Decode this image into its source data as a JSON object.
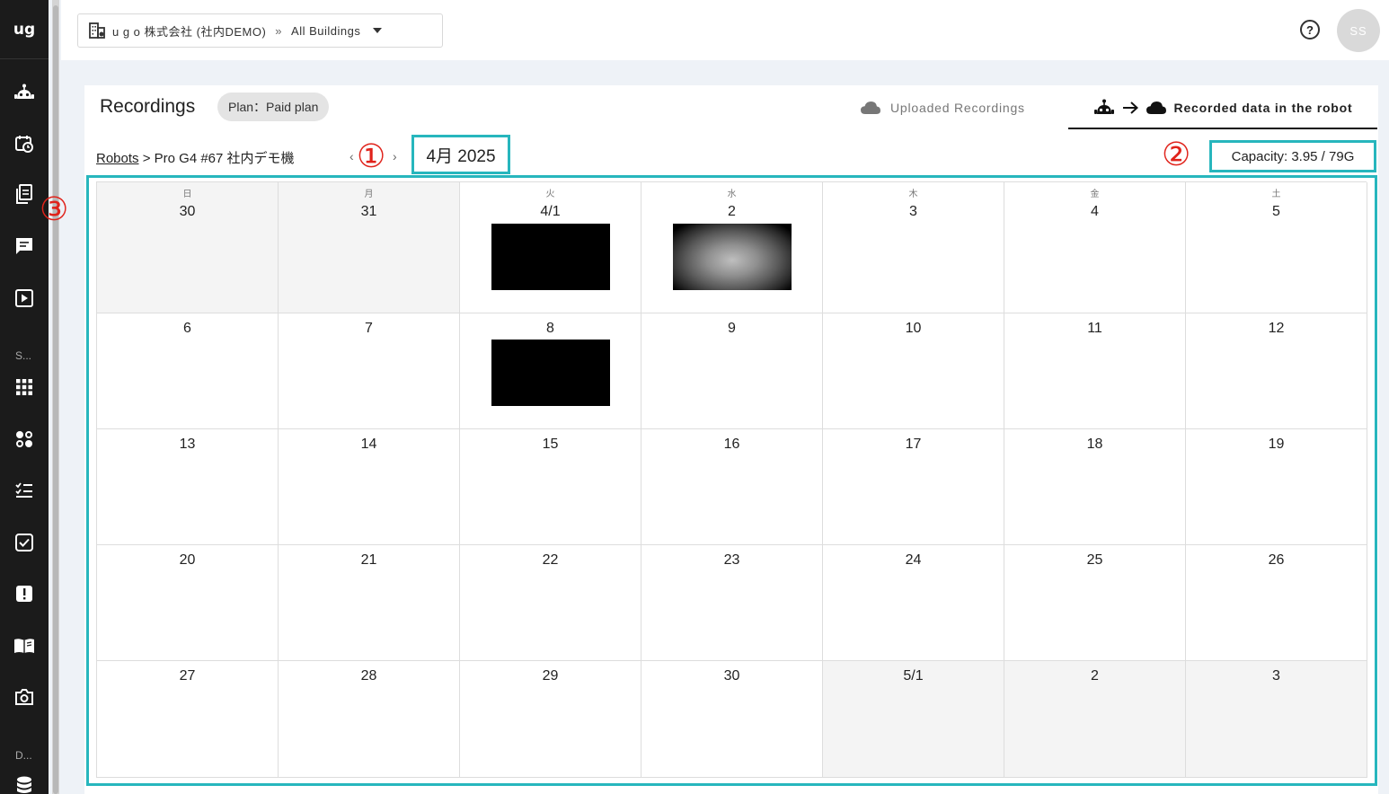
{
  "sidebar": {
    "logo": "ug",
    "section_labels": [
      "S...",
      "D..."
    ],
    "icons": [
      "robot-icon",
      "schedule-icon",
      "document-icon",
      "chat-icon",
      "play-icon",
      "grid-icon",
      "connection-icon",
      "checklist-icon",
      "check-box-icon",
      "alert-icon",
      "manual-icon",
      "camera-icon",
      "database-icon"
    ]
  },
  "topbar": {
    "company": "u g o 株式会社 (社内DEMO)",
    "separator": "»",
    "building": "All Buildings",
    "help": "?",
    "avatar": "SS"
  },
  "page": {
    "title": "Recordings",
    "plan": "Plan：Paid plan",
    "tabs": {
      "uploaded": "Uploaded Recordings",
      "recorded": "Recorded data in the robot",
      "active": "recorded"
    },
    "breadcrumb": {
      "root": "Robots",
      "separator": ">",
      "robot": "Pro G4 #67 社内デモ機"
    },
    "nav": {
      "prev": "‹",
      "next": "›"
    },
    "month": "4月 2025",
    "capacity": "Capacity: 3.95 / 79G"
  },
  "markers": [
    "①",
    "②",
    "③"
  ],
  "calendar": {
    "weekdays": [
      "日",
      "月",
      "火",
      "水",
      "木",
      "金",
      "土"
    ],
    "weeks": [
      [
        {
          "label": "30",
          "other": true,
          "thumb": ""
        },
        {
          "label": "31",
          "other": true,
          "thumb": ""
        },
        {
          "label": "4/1",
          "other": false,
          "thumb": "black"
        },
        {
          "label": "2",
          "other": false,
          "thumb": "camera"
        },
        {
          "label": "3",
          "other": false,
          "thumb": ""
        },
        {
          "label": "4",
          "other": false,
          "thumb": ""
        },
        {
          "label": "5",
          "other": false,
          "thumb": ""
        }
      ],
      [
        {
          "label": "6",
          "other": false,
          "thumb": ""
        },
        {
          "label": "7",
          "other": false,
          "thumb": ""
        },
        {
          "label": "8",
          "other": false,
          "thumb": "black"
        },
        {
          "label": "9",
          "other": false,
          "thumb": ""
        },
        {
          "label": "10",
          "other": false,
          "thumb": ""
        },
        {
          "label": "11",
          "other": false,
          "thumb": ""
        },
        {
          "label": "12",
          "other": false,
          "thumb": ""
        }
      ],
      [
        {
          "label": "13",
          "other": false,
          "thumb": ""
        },
        {
          "label": "14",
          "other": false,
          "thumb": ""
        },
        {
          "label": "15",
          "other": false,
          "thumb": ""
        },
        {
          "label": "16",
          "other": false,
          "thumb": ""
        },
        {
          "label": "17",
          "other": false,
          "thumb": ""
        },
        {
          "label": "18",
          "other": false,
          "thumb": ""
        },
        {
          "label": "19",
          "other": false,
          "thumb": ""
        }
      ],
      [
        {
          "label": "20",
          "other": false,
          "thumb": ""
        },
        {
          "label": "21",
          "other": false,
          "thumb": ""
        },
        {
          "label": "22",
          "other": false,
          "thumb": ""
        },
        {
          "label": "23",
          "other": false,
          "thumb": ""
        },
        {
          "label": "24",
          "other": false,
          "thumb": ""
        },
        {
          "label": "25",
          "other": false,
          "thumb": ""
        },
        {
          "label": "26",
          "other": false,
          "thumb": ""
        }
      ],
      [
        {
          "label": "27",
          "other": false,
          "thumb": ""
        },
        {
          "label": "28",
          "other": false,
          "thumb": ""
        },
        {
          "label": "29",
          "other": false,
          "thumb": ""
        },
        {
          "label": "30",
          "other": false,
          "thumb": ""
        },
        {
          "label": "5/1",
          "other": true,
          "thumb": ""
        },
        {
          "label": "2",
          "other": true,
          "thumb": ""
        },
        {
          "label": "3",
          "other": true,
          "thumb": ""
        }
      ]
    ]
  },
  "colors": {
    "highlight": "#27b6bd",
    "marker": "#e0231b",
    "sidebar": "#1b1b1b"
  }
}
